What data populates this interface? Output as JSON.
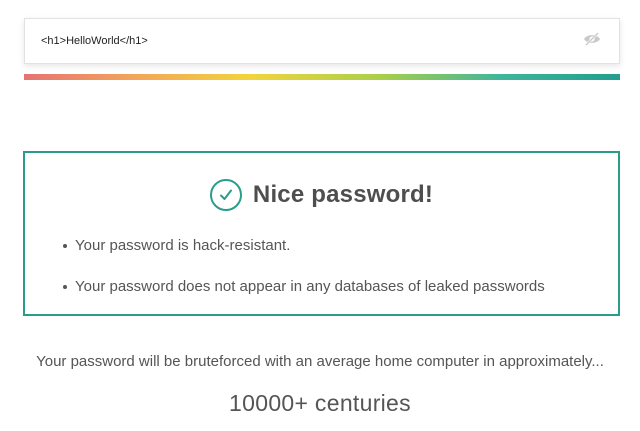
{
  "password_field": {
    "value": "<h1>HelloWorld</h1>",
    "toggle_icon": "eye-slash-icon"
  },
  "strength": {
    "level": 1.0,
    "gradient_colors": [
      "#e57373",
      "#f3a35a",
      "#f2d43b",
      "#a8cf4a",
      "#3fb59a",
      "#229e8e"
    ]
  },
  "result": {
    "icon": "check-circle-icon",
    "title": "Nice password!",
    "accent_color": "#2a9d8a",
    "items": [
      "Your password is hack-resistant.",
      "Your password does not appear in any databases of leaked passwords"
    ]
  },
  "bruteforce": {
    "text": "Your password will be bruteforced with an average home computer in approximately...",
    "time": "10000+ centuries"
  }
}
